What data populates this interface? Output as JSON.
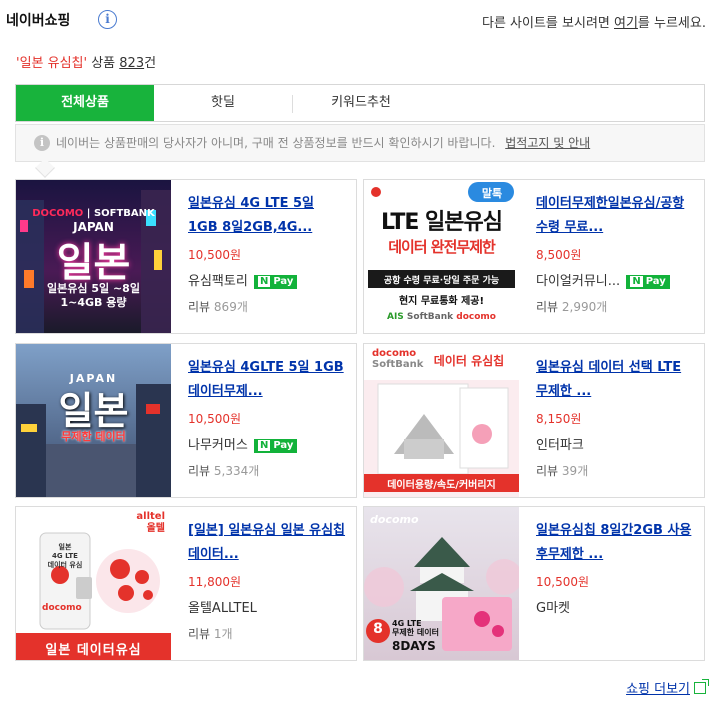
{
  "header": {
    "brand": "네이버쇼핑",
    "notice_prefix": "다른 사이트를 보시려면 ",
    "notice_link": "여기",
    "notice_suffix": "를 누르세요."
  },
  "search": {
    "query": "'일본 유심칩'",
    "count_label": " 상품 ",
    "count": "823",
    "count_unit": "건"
  },
  "tabs": [
    {
      "label": "전체상품",
      "active": true
    },
    {
      "label": "핫딜",
      "active": false
    },
    {
      "label": "키워드추천",
      "active": false
    }
  ],
  "disclaimer": {
    "text": "네이버는 상품판매의 당사자가 아니며, 구매 전 상품정보를 반드시 확인하시기 바랍니다.",
    "link": "법적고지 및 안내"
  },
  "products": [
    {
      "title": "일본유심 4G LTE 5일 1GB 8일2GB,4G...",
      "price": "10,500원",
      "mall": "유심팩토리",
      "npay": true,
      "review_label": "리뷰",
      "review_count": "869개",
      "thumb_text": [
        "DOCOMO",
        "SOFTBANK",
        "JAPAN",
        "일본",
        "일본유심 5일 ~8일",
        "1~4GB 용량"
      ]
    },
    {
      "title": "데이터무제한일본유심/공항수령 무료...",
      "price": "8,500원",
      "mall": "다이얼커뮤니...",
      "npay": true,
      "review_label": "리뷰",
      "review_count": "2,990개",
      "thumb_text": [
        "말톡",
        "LTE 일본유심",
        "데이터 완전무제한",
        "공항 수령 무료·당일 주문 가능",
        "현지 무료통화 제공!",
        "AIS",
        "SoftBank",
        "docomo"
      ]
    },
    {
      "title": "일본유심 4GLTE 5일 1GB 데이터무제...",
      "price": "10,500원",
      "mall": "나무커머스",
      "npay": true,
      "review_label": "리뷰",
      "review_count": "5,334개",
      "thumb_text": [
        "JAPAN",
        "일본",
        "무제한 데이터"
      ]
    },
    {
      "title": "일본유심 데이터 선택 LTE 무제한 ...",
      "price": "8,150원",
      "mall": "인터파크",
      "npay": false,
      "review_label": "리뷰",
      "review_count": "39개",
      "thumb_text": [
        "docomo",
        "SoftBank",
        "데이터 유심칩",
        "데이터용량/속도/커버리지"
      ]
    },
    {
      "title": "[일본] 일본유심 일본 유심칩 데이터...",
      "price": "11,800원",
      "mall": "올텔ALLTEL",
      "npay": false,
      "review_label": "리뷰",
      "review_count": "1개",
      "thumb_text": [
        "alltel",
        "올텔",
        "일본",
        "4G LTE",
        "데이터 유심",
        "docomo",
        "일본 데이터유심"
      ]
    },
    {
      "title": "일본유심칩 8일간2GB 사용후무제한 ...",
      "price": "10,500원",
      "mall": "G마켓",
      "npay": false,
      "review_label": "",
      "review_count": "",
      "thumb_text": [
        "docomo",
        "8",
        "4G LTE",
        "무제한 데이터",
        "8DAYS"
      ]
    }
  ],
  "npay_label": "Pay",
  "more_label": "쇼핑 더보기",
  "colors": {
    "green": "#18b33c",
    "price_red": "#e4322b",
    "link_blue": "#0033aa"
  }
}
